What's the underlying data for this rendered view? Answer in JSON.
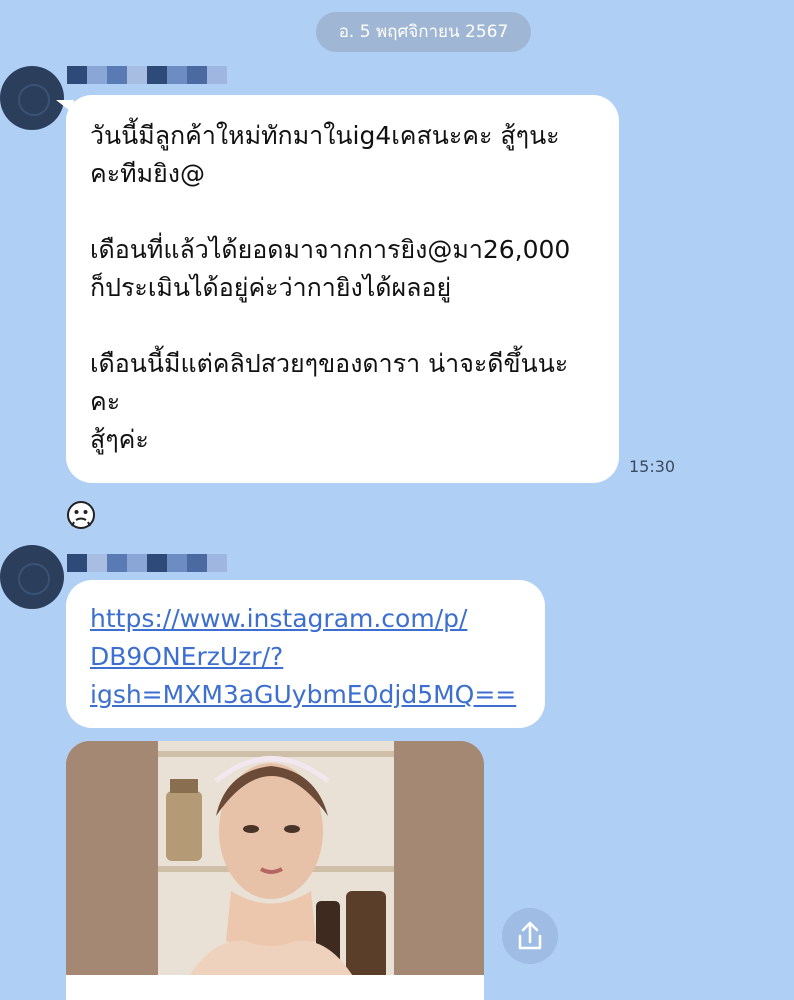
{
  "date_separator": "อ. 5 พฤศจิกายน 2567",
  "messages": [
    {
      "lines": [
        "วันนี้มีลูกค้าใหม่ทักมาในig4เคสนะคะ สู้ๆนะ",
        "คะทีมยิง@",
        "",
        "เดือนที่แล้วได้ยอดมาจากการยิง@มา26,000",
        "ก็ประเมินได้อยู่ค่ะว่ากายิงได้ผลอยู่",
        "",
        "เดือนนี้มีแต่คลิปสวยๆของดารา น่าจะดีขึ้นนะ",
        "คะ",
        "สู้ๆค่ะ"
      ],
      "time": "15:30"
    },
    {
      "link_lines": [
        "https://www.instagram.com/p/",
        "DB9ONErzUzr/?",
        "igsh=MXM3aGUybmE0djd5MQ=="
      ]
    }
  ],
  "icons": {
    "reaction": "face-reaction-icon",
    "share": "share-icon"
  },
  "colors": {
    "background": "#b0cff5",
    "bubble": "#ffffff",
    "link": "#3d6fd0",
    "date_pill": "#9fb6d4"
  }
}
